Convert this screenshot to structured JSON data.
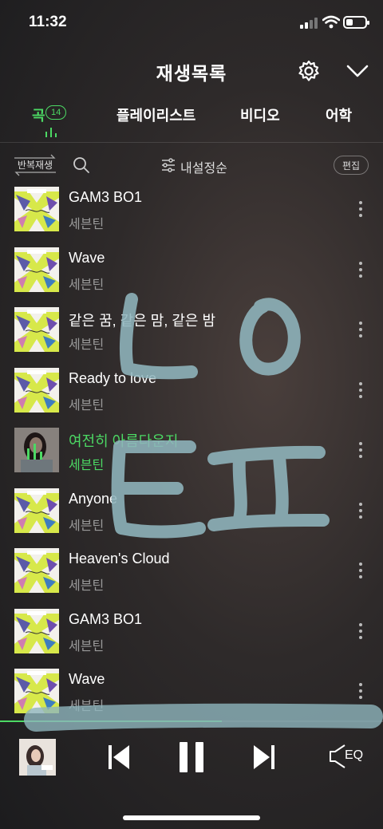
{
  "status_bar": {
    "time": "11:32",
    "battery_level": 0.35
  },
  "header": {
    "title": "재생목록",
    "settings_icon": "gear-icon",
    "collapse_icon": "chevron-down-icon"
  },
  "tabs": [
    {
      "label": "곡",
      "badge": "14"
    },
    {
      "label": "플레이리스트"
    },
    {
      "label": "비디오"
    },
    {
      "label": "어학"
    }
  ],
  "toolbar": {
    "repeat_label": "반복재생",
    "sort_label": "내설정순",
    "edit_label": "편집"
  },
  "songs": [
    {
      "title": "GAM3 BO1",
      "artist": "세븐틴"
    },
    {
      "title": "Wave",
      "artist": "세븐틴"
    },
    {
      "title": "같은 꿈, 같은 맘, 같은 밤",
      "artist": "세븐틴"
    },
    {
      "title": "Ready to love",
      "artist": "세븐틴"
    },
    {
      "title": "여전히 아름다운지",
      "artist": "세븐틴",
      "playing": true
    },
    {
      "title": "Anyone",
      "artist": "세븐틴"
    },
    {
      "title": "Heaven's Cloud",
      "artist": "세븐틴"
    },
    {
      "title": "GAM3 BO1",
      "artist": "세븐틴"
    },
    {
      "title": "Wave",
      "artist": "세븐틴"
    }
  ],
  "player": {
    "progress": 0.58,
    "eq_label": "EQ"
  },
  "colors": {
    "accent": "#4cd964",
    "scribble": "#8fb5bd"
  }
}
